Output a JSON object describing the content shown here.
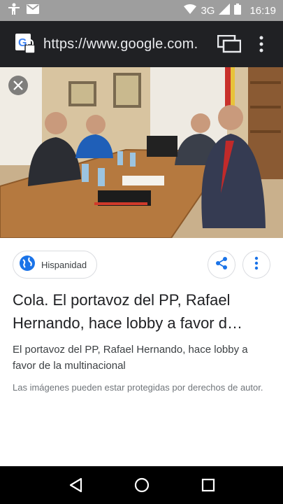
{
  "status_bar": {
    "network": "3G",
    "time": "16:19",
    "icons": [
      "accessibility-icon",
      "gmail-icon",
      "wifi-icon",
      "signal-icon",
      "battery-icon"
    ]
  },
  "browser": {
    "url": "https://www.google.com.",
    "favicon": "google-favicon",
    "tabs_icon": "tab-switcher-icon",
    "menu_icon": "more-vert-icon"
  },
  "result": {
    "source_name": "Hispanidad",
    "title": "Cola. El portavoz del PP, Rafael Hernando, hace lobby a favor d…",
    "subtitle": "El portavoz del PP, Rafael Hernando, hace lobby a favor de la multinacional",
    "copyright_note": "Las imágenes pueden estar protegidas por derechos de autor."
  },
  "colors": {
    "status_bar": "#9e9e9e",
    "toolbar": "#202124",
    "accent": "#1a73e8"
  }
}
